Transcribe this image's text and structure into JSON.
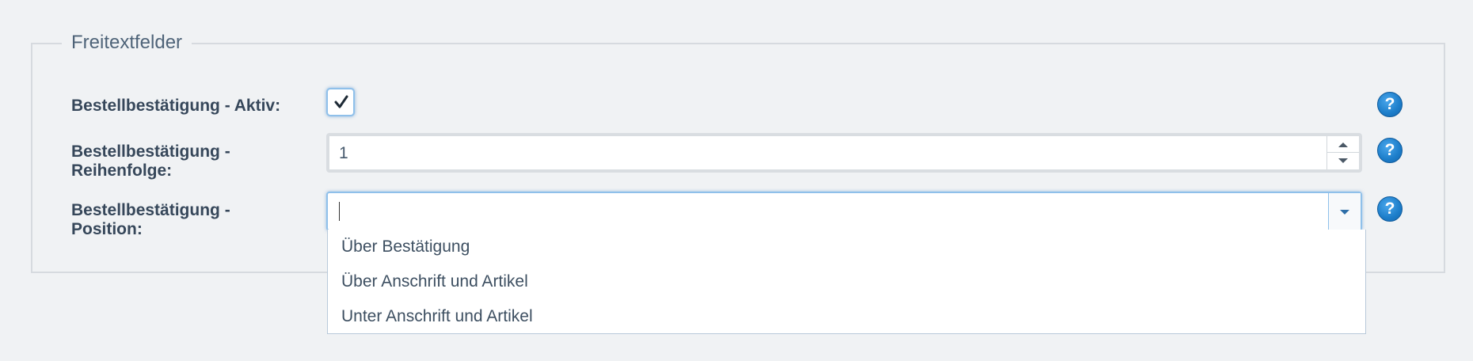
{
  "fieldset": {
    "legend": "Freitextfelder"
  },
  "fields": {
    "active": {
      "label": "Bestellbestätigung - Aktiv:",
      "checked": true
    },
    "order": {
      "label_line1": "Bestellbestätigung -",
      "label_line2": "Reihenfolge:",
      "value": "1"
    },
    "position": {
      "label_line1": "Bestellbestätigung -",
      "label_line2": "Position:",
      "value": ""
    }
  },
  "dropdown": {
    "options": [
      "Über Bestätigung",
      "Über Anschrift und Artikel",
      "Unter Anschrift und Artikel"
    ]
  },
  "help": {
    "glyph": "?"
  },
  "colors": {
    "accent": "#1c7dc9",
    "focus_border": "#8fc0ea",
    "label_text": "#36475a"
  }
}
